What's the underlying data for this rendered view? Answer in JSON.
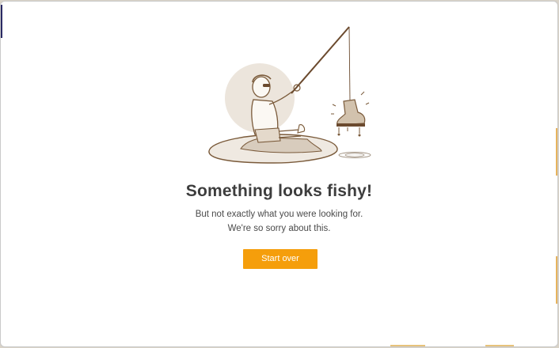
{
  "error_page": {
    "headline": "Something looks fishy!",
    "subtitle_line1": "But not exactly what you were looking for.",
    "subtitle_line2": "We're so sorry about this.",
    "start_over_label": "Start over",
    "illustration_icon": "fisherman-catching-boot-icon"
  },
  "colors": {
    "button": "#f59e0b",
    "headline": "#3d3d3d",
    "illustration_fill": "#e9e2d8",
    "illustration_stroke": "#7a5a3a"
  }
}
